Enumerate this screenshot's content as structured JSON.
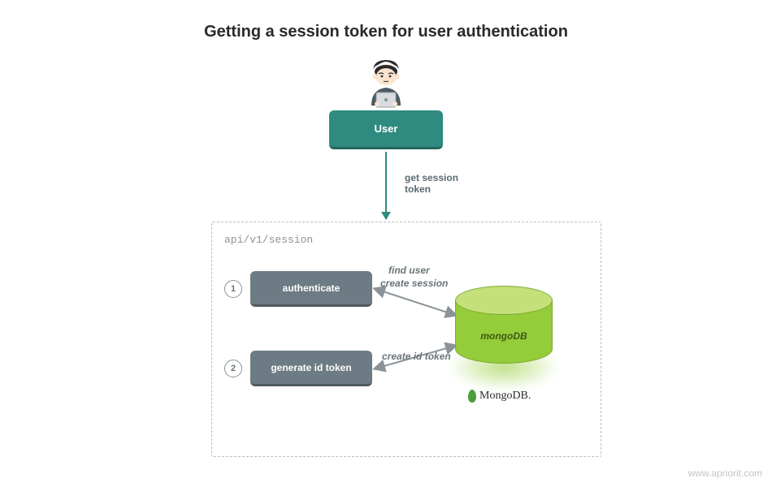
{
  "title": "Getting a session token for user authentication",
  "user": {
    "label": "User"
  },
  "arrow_label": "get session\ntoken",
  "api": {
    "path": "api/v1/session",
    "steps": [
      {
        "num": "1",
        "label": "authenticate"
      },
      {
        "num": "2",
        "label": "generate id token"
      }
    ]
  },
  "mongo": {
    "cylinder_label": "mongoDB",
    "brand": "MongoDB."
  },
  "connectors": {
    "find_user": "find user",
    "create_session": "create session",
    "create_id_token": "create id token"
  },
  "watermark": "www.apriorit.com",
  "colors": {
    "teal": "#2f8a7f",
    "slate": "#6d7c84",
    "green": "#95cc3a"
  }
}
